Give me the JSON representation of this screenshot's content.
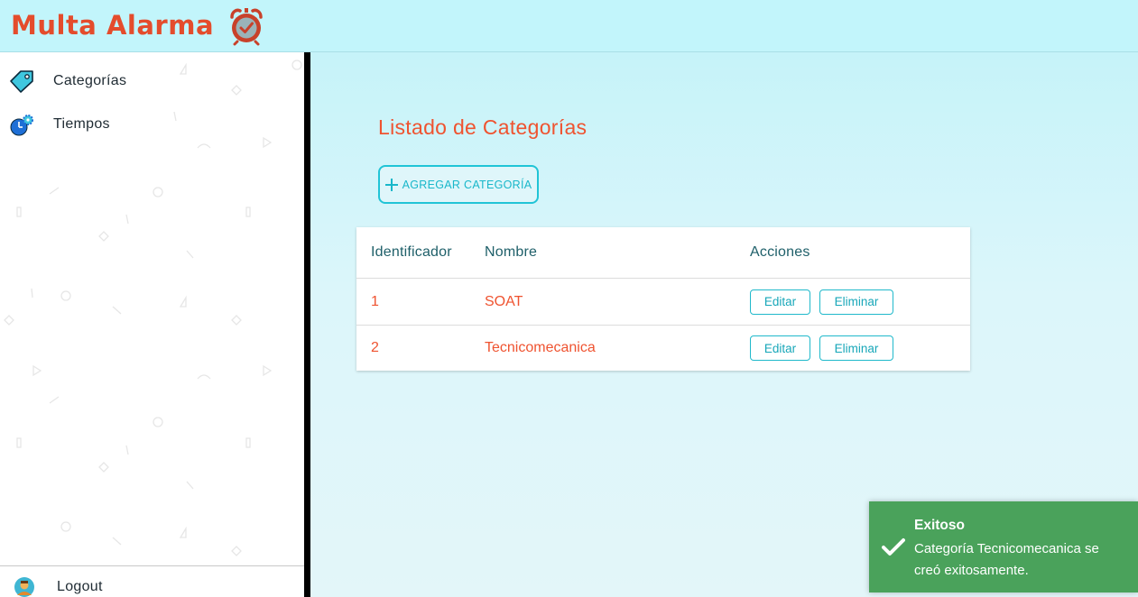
{
  "app": {
    "brand": "Multa Alarma",
    "brand_icon": "alarm-clock-icon",
    "colors": {
      "brand": "#e44c2c",
      "header_bg": "#c2f5fb",
      "accent": "#20c4d6",
      "title": "#ef5330",
      "toast_success": "#4aa25b"
    }
  },
  "sidebar": {
    "items": [
      {
        "label": "Categorías",
        "icon": "tag-icon"
      },
      {
        "label": "Tiempos",
        "icon": "clock-gear-icon"
      }
    ],
    "logout": {
      "label": "Logout",
      "icon": "user-avatar-icon"
    }
  },
  "main": {
    "title": "Listado de Categorías",
    "add_button": {
      "label": "AGREGAR CATEGORÍA",
      "icon": "plus-icon"
    },
    "table": {
      "columns": [
        "Identificador",
        "Nombre",
        "Acciones"
      ],
      "rows": [
        {
          "id": "1",
          "name": "SOAT",
          "edit": "Editar",
          "delete": "Eliminar"
        },
        {
          "id": "2",
          "name": "Tecnicomecanica",
          "edit": "Editar",
          "delete": "Eliminar"
        }
      ]
    }
  },
  "toast": {
    "title": "Exitoso",
    "message": "Categoría Tecnicomecanica se creó exitosamente.",
    "icon": "checkmark-icon"
  }
}
